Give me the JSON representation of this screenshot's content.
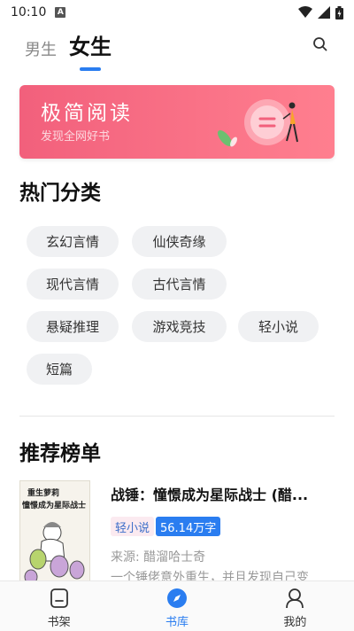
{
  "status_bar": {
    "time": "10:10",
    "notif_letter": "A"
  },
  "top_tabs": [
    {
      "label": "男生",
      "active": false
    },
    {
      "label": "女生",
      "active": true
    }
  ],
  "banner": {
    "title": "极简阅读",
    "subtitle": "发现全网好书"
  },
  "hot_section": {
    "title": "热门分类",
    "tags": [
      "玄幻言情",
      "仙侠奇缘",
      "现代言情",
      "古代言情",
      "悬疑推理",
      "游戏竞技",
      "轻小说",
      "短篇"
    ]
  },
  "rec_section": {
    "title": "推荐榜单",
    "books": [
      {
        "cover_line1": "重生萝莉",
        "cover_line2": "憧憬成为星际战士",
        "title": "战锤：憧憬成为星际战士 (醋...",
        "category": "轻小说",
        "words": "56.14万字",
        "author": "来源: 醋溜哈士奇",
        "desc": "一个锤佬意外重生，并且发现自己变"
      }
    ]
  },
  "bottom_nav": [
    {
      "label": "书架",
      "icon": "bookshelf-icon",
      "active": false
    },
    {
      "label": "书库",
      "icon": "compass-icon",
      "active": true
    },
    {
      "label": "我的",
      "icon": "user-icon",
      "active": false
    }
  ],
  "colors": {
    "accent": "#2a7df0",
    "banner": "#f2607c"
  }
}
